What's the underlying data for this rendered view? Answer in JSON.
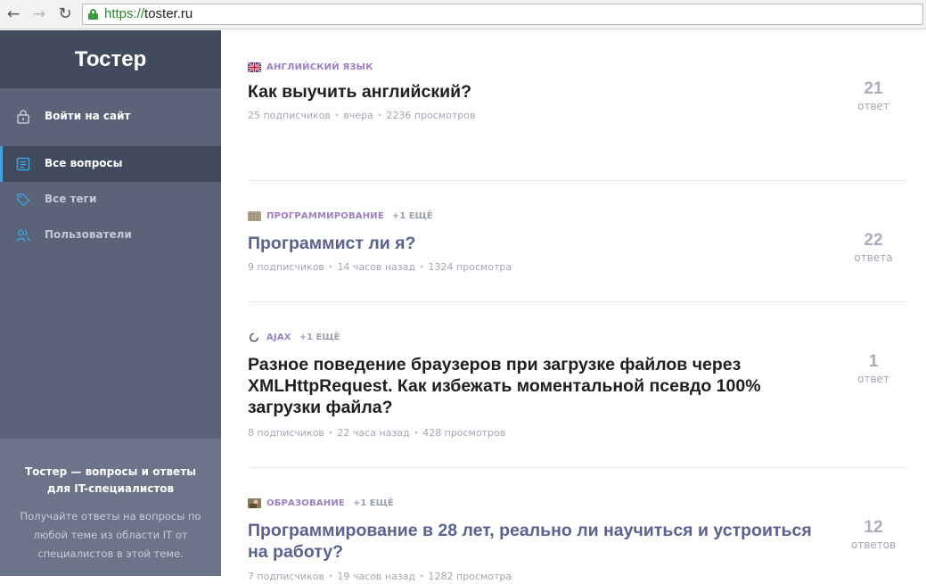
{
  "browser": {
    "url_scheme": "https://",
    "url_host": "toster.ru"
  },
  "sidebar": {
    "logo": "Тостер",
    "login_label": "Войти на сайт",
    "nav": [
      {
        "label": "Все вопросы"
      },
      {
        "label": "Все теги"
      },
      {
        "label": "Пользователи"
      }
    ],
    "footer_title": "Тостер — вопросы и ответы для IT-специалистов",
    "footer_text": "Получайте ответы на вопросы по любой теме из области IT от специалистов в этой теме."
  },
  "questions": [
    {
      "tag": "АНГЛИЙСКИЙ ЯЗЫК",
      "more": "",
      "title": "Как выучить английский?",
      "subscribers": "25 подписчиков",
      "time": "вчера",
      "views": "2236 просмотров",
      "answers": "21",
      "answers_unit": "ответ"
    },
    {
      "tag": "ПРОГРАММИРОВАНИЕ",
      "more": "+1 ЕЩЁ",
      "title": "Программист ли я?",
      "subscribers": "9 подписчиков",
      "time": "14 часов назад",
      "views": "1324 просмотра",
      "answers": "22",
      "answers_unit": "ответа"
    },
    {
      "tag": "AJAX",
      "more": "+1 ЕЩЁ",
      "title": "Разное поведение браузеров при загрузке файлов через XMLHttpRequest. Как избежать моментальной псевдо 100% загрузки файла?",
      "subscribers": "8 подписчиков",
      "time": "22 часа назад",
      "views": "428 просмотров",
      "answers": "1",
      "answers_unit": "ответ"
    },
    {
      "tag": "ОБРАЗОВАНИЕ",
      "more": "+1 ЕЩЁ",
      "title": "Программирование в 28 лет, реально ли научиться и устроиться на работу?",
      "subscribers": "7 подписчиков",
      "time": "19 часов назад",
      "views": "1282 просмотра",
      "answers": "12",
      "answers_unit": "ответов"
    }
  ],
  "colors": {
    "sidebar_bg": "#5a6377",
    "sidebar_dark": "#424a5d",
    "accent_blue": "#3aa3e3",
    "tag_purple": "#9b7fc0",
    "visited_title": "#5c6190"
  }
}
